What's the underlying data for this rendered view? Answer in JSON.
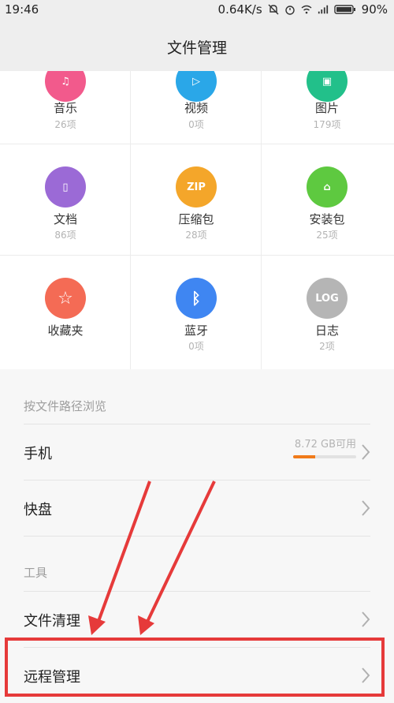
{
  "status_bar": {
    "time": "19:46",
    "speed": "0.64K/s",
    "battery": "90%"
  },
  "header": {
    "title": "文件管理"
  },
  "categories": [
    {
      "label": "音乐",
      "count": "26项",
      "icon": "music-icon",
      "color": "#f25a8c",
      "glyph": "♫"
    },
    {
      "label": "视频",
      "count": "0项",
      "icon": "video-play-icon",
      "color": "#2aa7e8",
      "glyph": "▷"
    },
    {
      "label": "图片",
      "count": "179项",
      "icon": "image-icon",
      "color": "#22c08a",
      "glyph": "▣"
    },
    {
      "label": "文档",
      "count": "86项",
      "icon": "document-icon",
      "color": "#9b6ad6",
      "glyph": "▯"
    },
    {
      "label": "压缩包",
      "count": "28项",
      "icon": "zip-icon",
      "color": "#f4a62a",
      "glyph": "ZIP"
    },
    {
      "label": "安装包",
      "count": "25项",
      "icon": "android-icon",
      "color": "#5ec940",
      "glyph": "⌂"
    },
    {
      "label": "收藏夹",
      "count": "",
      "icon": "star-icon",
      "color": "#f46b55",
      "glyph": "☆"
    },
    {
      "label": "蓝牙",
      "count": "0项",
      "icon": "bluetooth-icon",
      "color": "#3f86f2",
      "glyph": "ᛒ"
    },
    {
      "label": "日志",
      "count": "2项",
      "icon": "log-icon",
      "color": "#b5b5b5",
      "glyph": "LOG"
    }
  ],
  "path_section": {
    "title": "按文件路径浏览"
  },
  "storage_rows": [
    {
      "label": "手机",
      "available": "8.72 GB可用",
      "used_fraction": 0.35
    },
    {
      "label": "快盘"
    }
  ],
  "tools_section": {
    "title": "工具"
  },
  "tool_rows": [
    {
      "label": "文件清理"
    },
    {
      "label": "远程管理"
    }
  ],
  "colors": {
    "highlight": "#e63a3a",
    "storage_bar": "#f07b1a"
  }
}
